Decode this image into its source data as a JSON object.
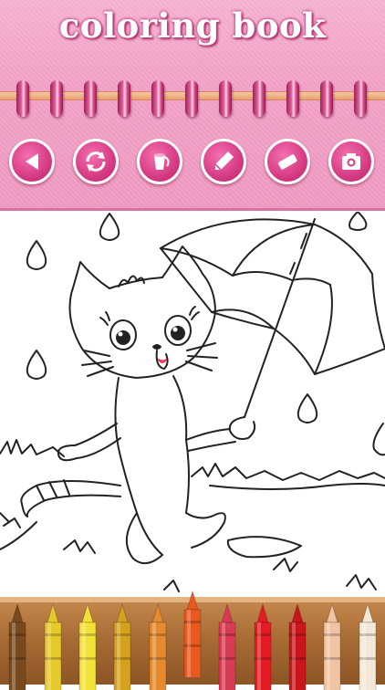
{
  "app": {
    "title": "coloring book"
  },
  "toolbar": {
    "tools": [
      {
        "name": "back",
        "icon": "back-icon"
      },
      {
        "name": "refresh",
        "icon": "refresh-icon"
      },
      {
        "name": "bucket",
        "icon": "paint-bucket-icon"
      },
      {
        "name": "pencil",
        "icon": "pencil-icon"
      },
      {
        "name": "eraser",
        "icon": "eraser-icon"
      },
      {
        "name": "camera",
        "icon": "camera-icon"
      }
    ]
  },
  "palette": {
    "colors": [
      "#7a4a1f",
      "#e6c92b",
      "#f3e23a",
      "#d4a21e",
      "#e58b2e",
      "#e8581f",
      "#d93a55",
      "#e21c23",
      "#c8161b",
      "#f0c4a2",
      "#f4e9d8"
    ],
    "selected_index": 5
  }
}
